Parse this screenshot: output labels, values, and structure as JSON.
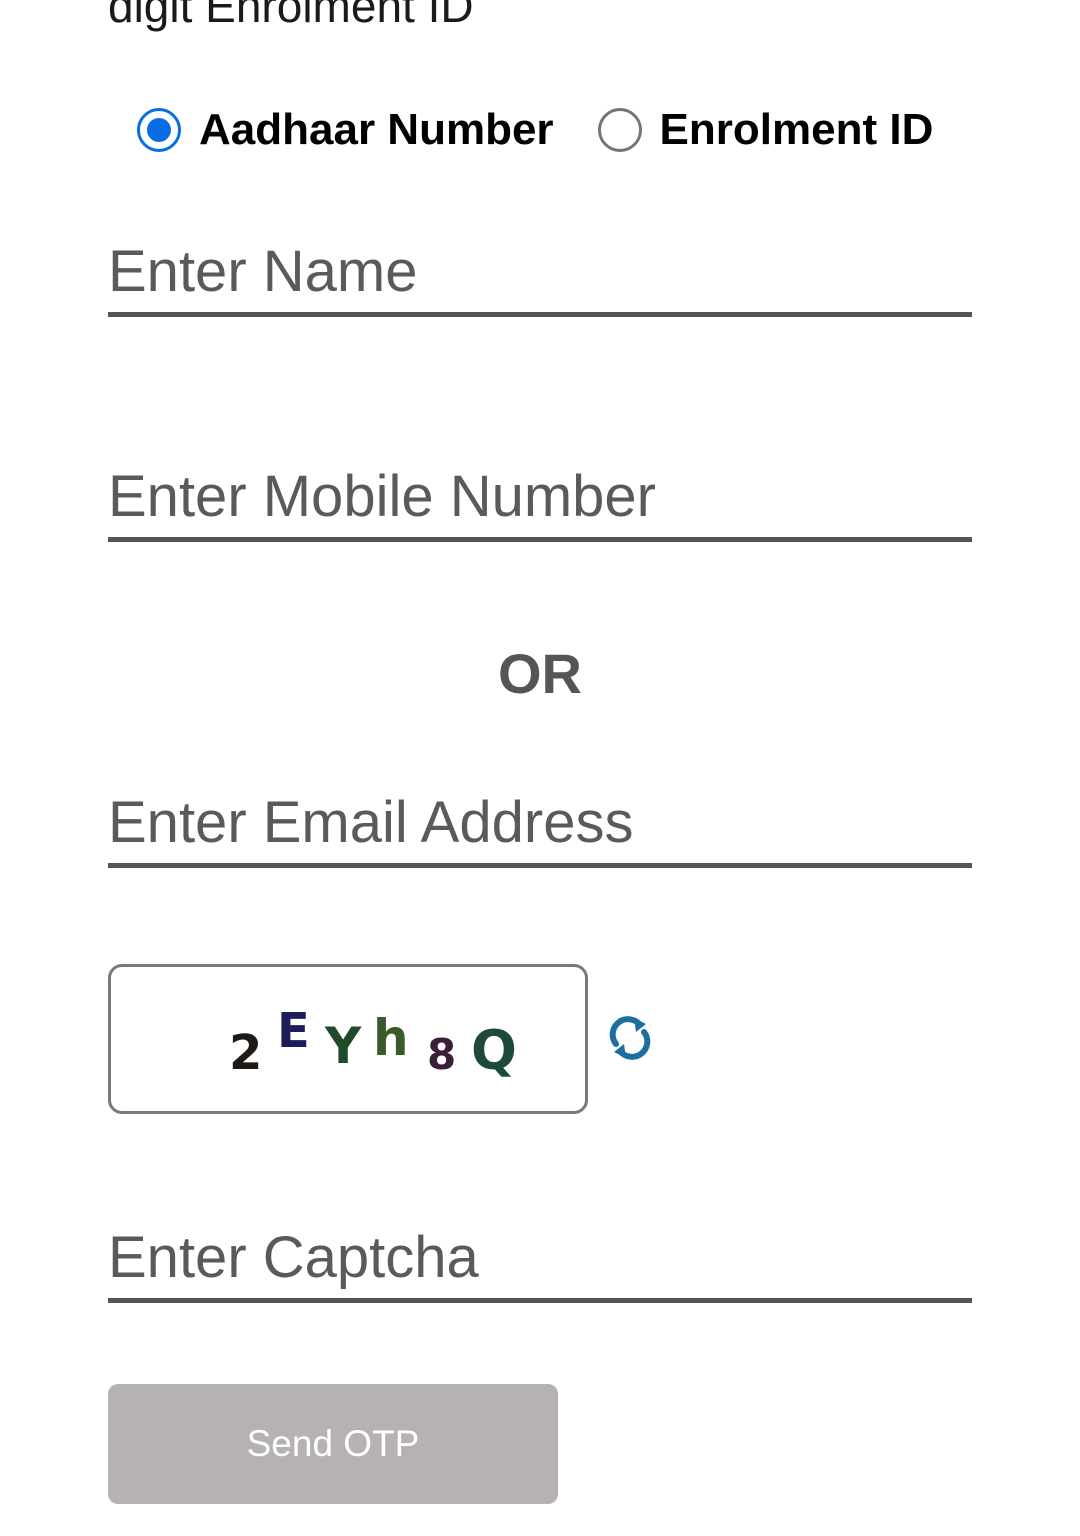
{
  "form": {
    "id_label_fragment": "digit Enrolment ID",
    "id_type_options": [
      {
        "label": "Aadhaar Number",
        "selected": true
      },
      {
        "label": "Enrolment ID",
        "selected": false
      }
    ],
    "name_placeholder": "Enter Name",
    "mobile_placeholder": "Enter Mobile Number",
    "or_separator": "OR",
    "email_placeholder": "Enter Email Address",
    "captcha_placeholder": "Enter Captcha",
    "send_otp_label": "Send OTP"
  },
  "captcha": {
    "text": "2EYh8Q",
    "chars": [
      {
        "ch": "2",
        "color": "#1f1a16"
      },
      {
        "ch": "E",
        "color": "#1e1c5a"
      },
      {
        "ch": "Y",
        "color": "#1f4a2a"
      },
      {
        "ch": "h",
        "color": "#3b5a2a"
      },
      {
        "ch": "8",
        "color": "#3a1f3a"
      },
      {
        "ch": "Q",
        "color": "#1f4a3a"
      }
    ]
  },
  "icons": {
    "refresh": "refresh-icon",
    "refresh_color": "#1e6fa0"
  },
  "colors": {
    "radio_selected": "#0a6de6",
    "field_underline": "#555555",
    "button_disabled": "#b5b2b1"
  }
}
